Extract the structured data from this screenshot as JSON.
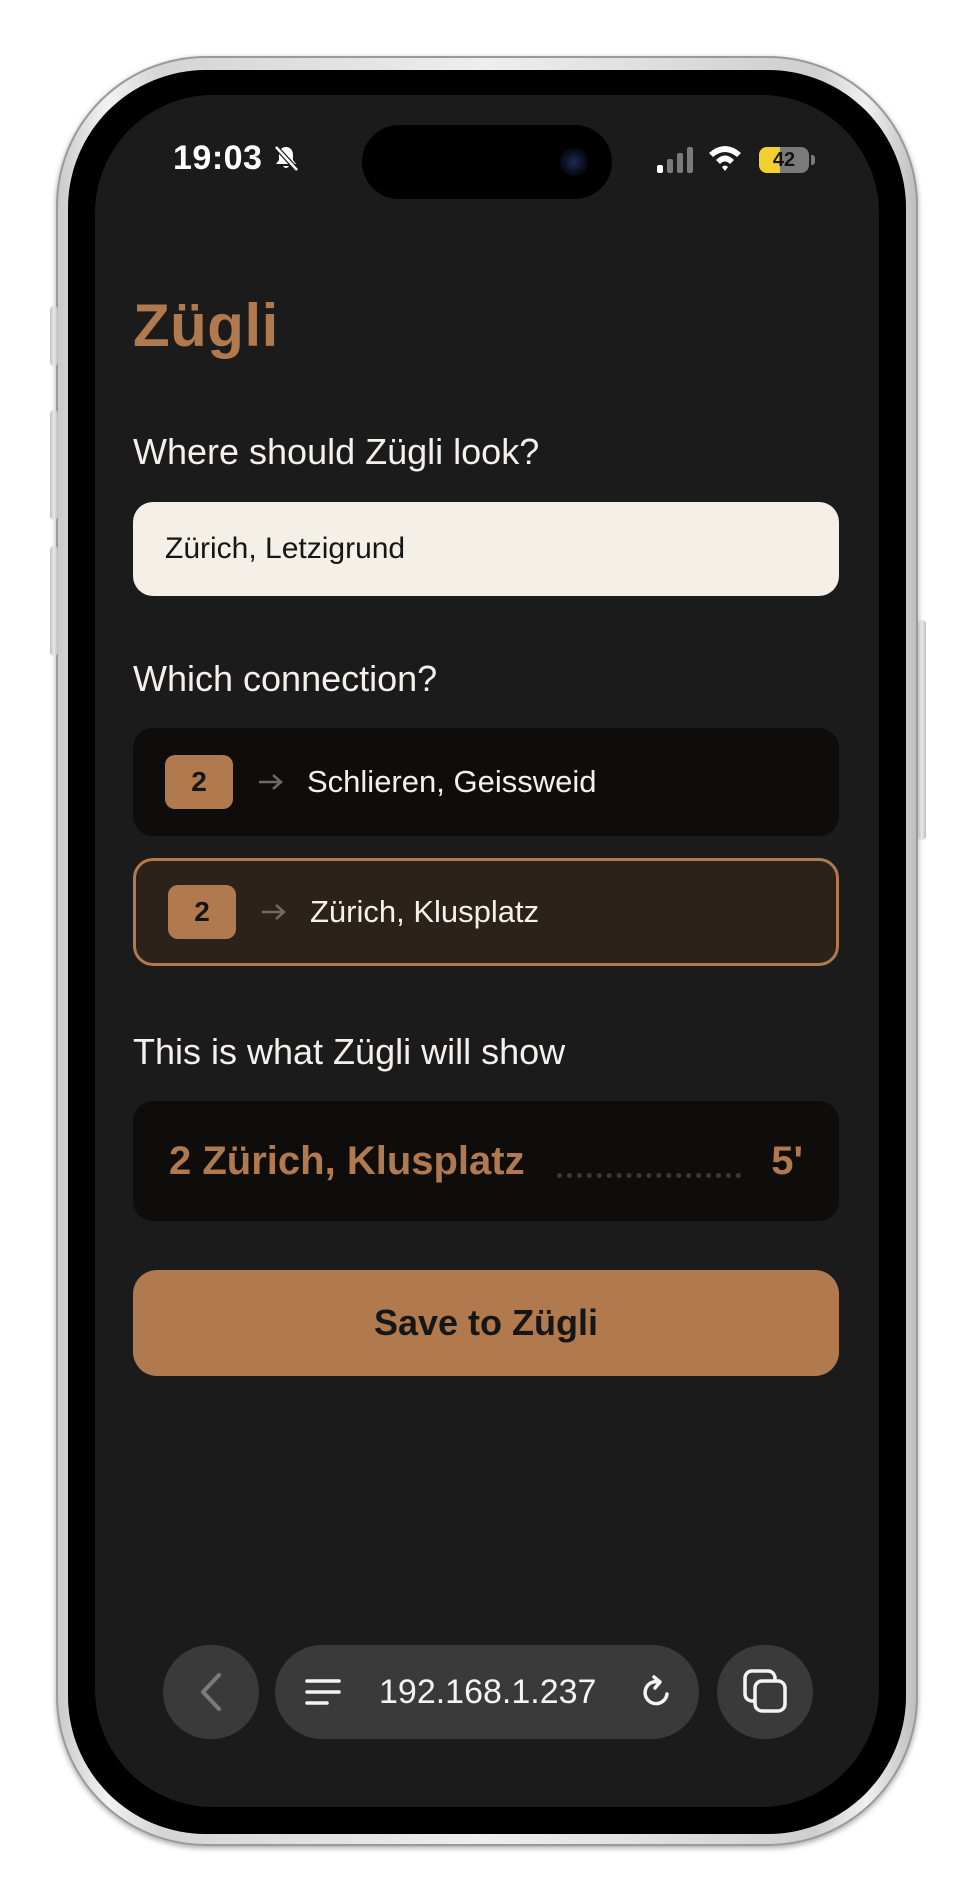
{
  "status_bar": {
    "time": "19:03",
    "battery_level": "42",
    "battery_fraction": 0.42
  },
  "app": {
    "title": "Zügli"
  },
  "location": {
    "label": "Where should Zügli look?",
    "value": "Zürich, Letzigrund"
  },
  "connection": {
    "label": "Which connection?",
    "options": [
      {
        "line": "2",
        "destination": "Schlieren, Geissweid",
        "selected": false
      },
      {
        "line": "2",
        "destination": "Zürich, Klusplatz",
        "selected": true
      }
    ]
  },
  "preview": {
    "label": "This is what Zügli will show",
    "line_text": "2 Zürich, Klusplatz",
    "minutes": "5'"
  },
  "actions": {
    "save_label": "Save to Zügli"
  },
  "browser": {
    "address": "192.168.1.237"
  },
  "colors": {
    "accent": "#b0794e",
    "background": "#1b1b1b",
    "card": "#0e0d0c",
    "selected_card": "#2b2219",
    "input": "#f4efe7"
  },
  "icons": [
    "bell-slash-icon",
    "signal-icon",
    "wifi-icon",
    "battery-icon",
    "arrow-right-icon",
    "chevron-left-icon",
    "menu-icon",
    "reload-icon",
    "tabs-icon"
  ]
}
